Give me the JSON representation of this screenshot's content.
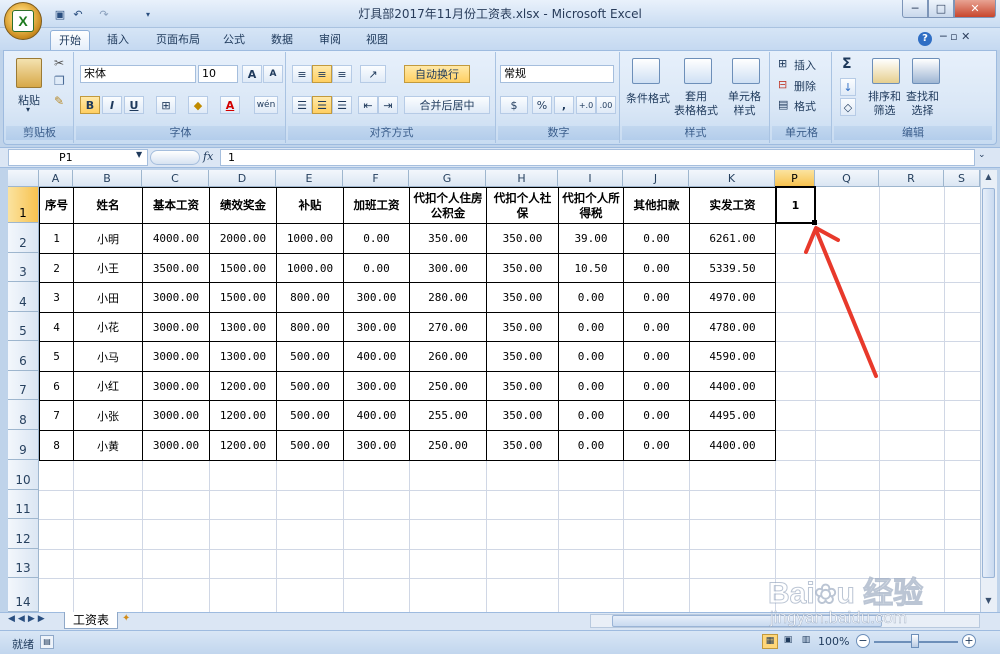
{
  "window": {
    "title": "灯具部2017年11月份工资表.xlsx - Microsoft Excel",
    "min": "─",
    "max": "□",
    "close": "✕"
  },
  "qat": {
    "save_icon": "save-icon",
    "undo_icon": "undo-icon",
    "redo_icon": "redo-icon"
  },
  "tabs": [
    "开始",
    "插入",
    "页面布局",
    "公式",
    "数据",
    "审阅",
    "视图"
  ],
  "ribbon": {
    "clipboard": {
      "label": "剪贴板",
      "paste": "粘贴"
    },
    "font": {
      "label": "字体",
      "name": "宋体",
      "size": "10",
      "bold": "B",
      "italic": "I",
      "underline": "U",
      "grow": "A",
      "shrink": "A",
      "fontcolor": "A",
      "wen": "wén"
    },
    "align": {
      "label": "对齐方式",
      "wrap": "自动换行",
      "merge": "合并后居中"
    },
    "number": {
      "label": "数字",
      "format": "常规",
      "percent": "%",
      "comma": ",",
      "inc": "+.0",
      "dec": ".00"
    },
    "styles": {
      "label": "样式",
      "cond": "条件格式",
      "table": "套用\n表格格式",
      "cell": "单元格\n样式"
    },
    "cells": {
      "label": "单元格",
      "insert": "插入",
      "delete": "删除",
      "format": "格式"
    },
    "edit": {
      "label": "编辑",
      "sigma": "Σ",
      "sort": "排序和\n筛选",
      "find": "查找和\n选择"
    }
  },
  "formula": {
    "namebox": "P1",
    "fx": "fx",
    "value": "1"
  },
  "columns": [
    "A",
    "B",
    "C",
    "D",
    "E",
    "F",
    "G",
    "H",
    "I",
    "J",
    "K",
    "P",
    "Q",
    "R",
    "S"
  ],
  "rows": [
    "1",
    "2",
    "3",
    "4",
    "5",
    "6",
    "7",
    "8",
    "9",
    "10",
    "11",
    "12",
    "13",
    "14"
  ],
  "table": {
    "headers": [
      "序号",
      "姓名",
      "基本工资",
      "绩效奖金",
      "补贴",
      "加班工资",
      "代扣个人住房公积金",
      "代扣个人社保",
      "代扣个人所得税",
      "其他扣款",
      "实发工资"
    ],
    "rows": [
      [
        "1",
        "小明",
        "4000.00",
        "2000.00",
        "1000.00",
        "0.00",
        "350.00",
        "350.00",
        "39.00",
        "0.00",
        "6261.00"
      ],
      [
        "2",
        "小王",
        "3500.00",
        "1500.00",
        "1000.00",
        "0.00",
        "300.00",
        "350.00",
        "10.50",
        "0.00",
        "5339.50"
      ],
      [
        "3",
        "小田",
        "3000.00",
        "1500.00",
        "800.00",
        "300.00",
        "280.00",
        "350.00",
        "0.00",
        "0.00",
        "4970.00"
      ],
      [
        "4",
        "小花",
        "3000.00",
        "1300.00",
        "800.00",
        "300.00",
        "270.00",
        "350.00",
        "0.00",
        "0.00",
        "4780.00"
      ],
      [
        "5",
        "小马",
        "3000.00",
        "1300.00",
        "500.00",
        "400.00",
        "260.00",
        "350.00",
        "0.00",
        "0.00",
        "4590.00"
      ],
      [
        "6",
        "小红",
        "3000.00",
        "1200.00",
        "500.00",
        "300.00",
        "250.00",
        "350.00",
        "0.00",
        "0.00",
        "4400.00"
      ],
      [
        "7",
        "小张",
        "3000.00",
        "1200.00",
        "500.00",
        "400.00",
        "255.00",
        "350.00",
        "0.00",
        "0.00",
        "4495.00"
      ],
      [
        "8",
        "小黄",
        "3000.00",
        "1200.00",
        "500.00",
        "300.00",
        "250.00",
        "350.00",
        "0.00",
        "0.00",
        "4400.00"
      ]
    ]
  },
  "selected_cell": {
    "value": "1"
  },
  "sheet_tab": "工资表",
  "status": {
    "ready": "就绪",
    "zoom": "100%"
  },
  "watermark": "Bai 经验 jingyan.baidu.com",
  "colors": {
    "arrow": "#e8392b",
    "selection": "#000000"
  }
}
